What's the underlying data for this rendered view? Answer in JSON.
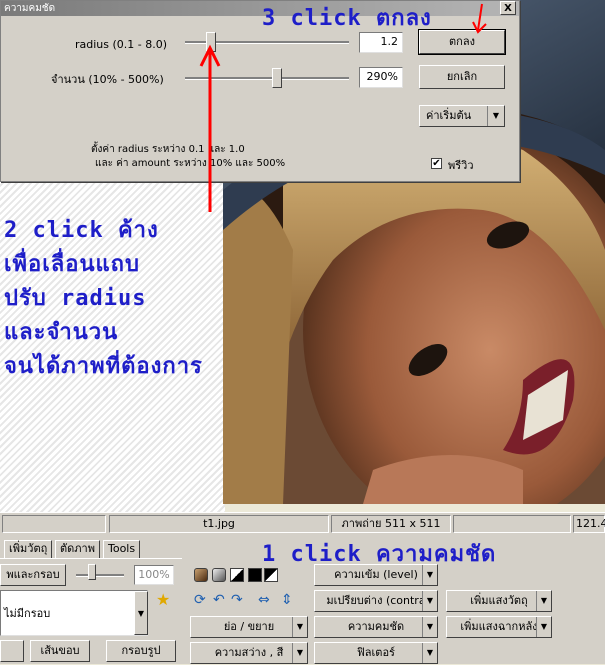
{
  "dialog": {
    "title": "ความคมชัด",
    "close_label": "X",
    "radius_label": "radius (0.1 - 8.0)",
    "radius_value": "1.2",
    "amount_label": "จำนวน (10% - 500%)",
    "amount_value": "290%",
    "ok_label": "ตกลง",
    "cancel_label": "ยกเลิก",
    "defaults_label": "ค่าเริ่มต้น",
    "defaults_arrow": "▼",
    "note_line1": "ตั้งค่า  radius ระหว่าง 0.1 และ 1.0",
    "note_line2": "และ ค่า amount ระหว่าง 10% และ 500%",
    "preview_label": "พรีวิว",
    "preview_checked": "✔"
  },
  "annotations": {
    "step3": "3 click ตกลง",
    "step2_lines": [
      "2 click ค้าง",
      "เพื่อเลื่อนแถบ",
      "ปรับ radius",
      "และจำนวน",
      "จนได้ภาพที่ต้องการ"
    ],
    "step1": "1 click ความคมชัด",
    "color": "#1e1ec8",
    "arrow_color": "#ff0000"
  },
  "statusbar": {
    "filename": "t1.jpg",
    "image_info": "ภาพถ่าย 511 x 511",
    "zoom": "121.4"
  },
  "tabs": [
    "เพิ่มวัตถุ",
    "ตัดภาพ",
    "Tools"
  ],
  "bottom": {
    "frame_button": "พและกรอบ",
    "opacity_value": "100%",
    "frame_select": "ไม่มีกรอบ",
    "border_button": "เส้นขอบ",
    "frame_image_button": "กรอบรูป",
    "resize_button": "ย่อ / ขยาย",
    "brightness_button": "ความสว่าง , สี",
    "level_button": "ความเข้ม (level)",
    "contrast_button": "มเปรียบต่าง (contra",
    "sharpness_button": "ความคมชัด",
    "filter_button": "ฟิลเตอร์",
    "object_light_button": "เพิ่มแสงวัตถุ",
    "background_light_button": "เพิ่มแสงฉากหลัง",
    "dd_arrow": "▼"
  }
}
